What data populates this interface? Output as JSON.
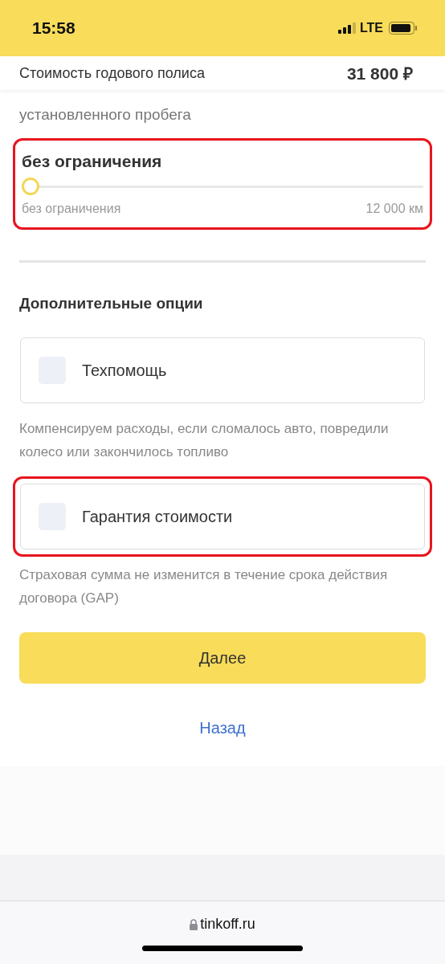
{
  "status_bar": {
    "time": "15:58",
    "network": "LTE"
  },
  "price_bar": {
    "label": "Стоимость годового полиса",
    "value": "31 800 ₽"
  },
  "mileage": {
    "caption": "установленного пробега",
    "highlighted": true,
    "title": "без ограничения",
    "level": 0,
    "min_label": "без ограничения",
    "max_label": "12 000 км"
  },
  "options": {
    "title": "Дополнительные опции",
    "items": [
      {
        "label": "Техпомощь",
        "checked": false,
        "highlighted": false,
        "description": "Компенсируем расходы, если сломалось авто, повредили колесо или закончилось топливо"
      },
      {
        "label": "Гарантия стоимости",
        "checked": false,
        "highlighted": true,
        "description": "Страховая сумма не изменится в течение срока действия договора (GAP)"
      }
    ]
  },
  "buttons": {
    "next": "Далее",
    "back": "Назад"
  },
  "browser_bar": {
    "url": "tinkoff.ru"
  }
}
